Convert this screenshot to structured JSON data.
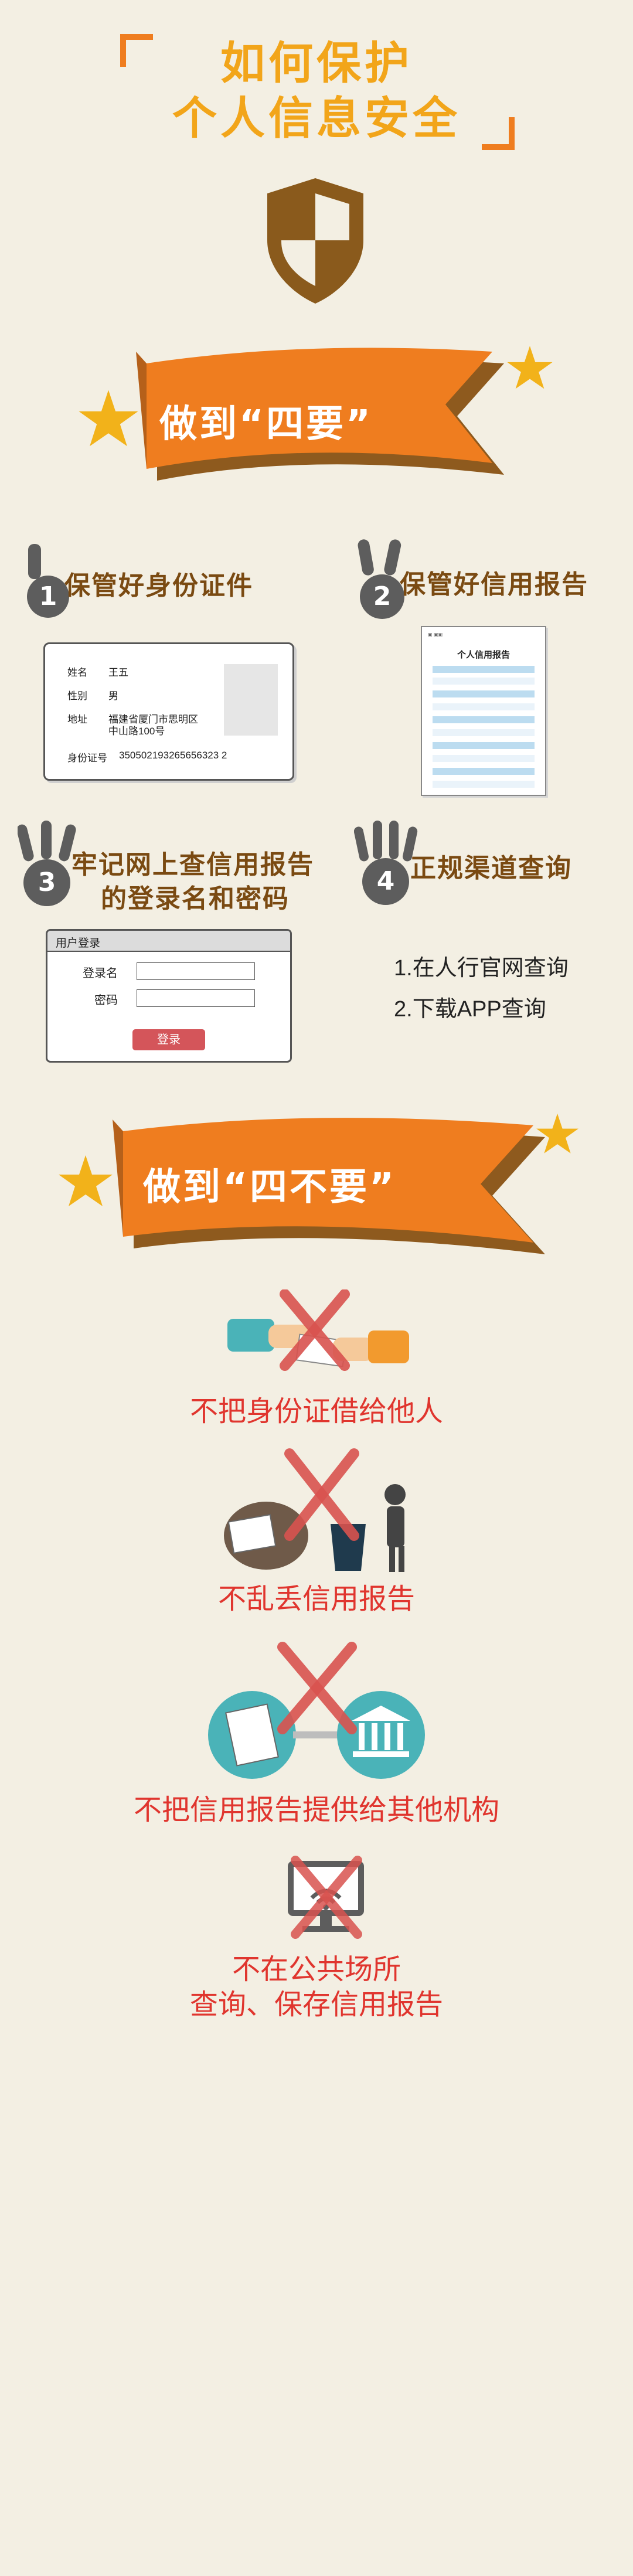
{
  "title": {
    "line1": "如何保护",
    "line2": "个人信息安全"
  },
  "banner1": {
    "text": "做到“四要”"
  },
  "banner2": {
    "text": "做到“四不要”"
  },
  "musts": [
    {
      "num": "1",
      "title": "保管好身份证件"
    },
    {
      "num": "2",
      "title": "保管好信用报告"
    },
    {
      "num": "3",
      "title_line1": "牢记网上查信用报告",
      "title_line2": "的登录名和密码"
    },
    {
      "num": "4",
      "title": "正规渠道查询"
    }
  ],
  "id_card": {
    "name_label": "姓名",
    "name_value": "王五",
    "gender_label": "性别",
    "gender_value": "男",
    "address_label": "地址",
    "address_line1": "福建省厦门市思明区",
    "address_line2": "中山路100号",
    "idno_label": "身份证号",
    "idno_value": "350502193265656323 2"
  },
  "report": {
    "title": "个人信用报告"
  },
  "login": {
    "header": "用户登录",
    "username_label": "登录名",
    "password_label": "密码",
    "submit": "登录"
  },
  "query_methods": [
    "1.在人行官网查询",
    "2.下载APP查询"
  ],
  "donts": [
    {
      "caption": "不把身份证借给他人"
    },
    {
      "caption": "不乱丢信用报告"
    },
    {
      "caption": "不把信用报告提供给其他机构"
    },
    {
      "caption_line1": "不在公共场所",
      "caption_line2": "查询、保存信用报告"
    }
  ],
  "colors": {
    "orange": "#ef7d1f",
    "gold": "#f2a51a",
    "brown": "#7a4a12",
    "red": "#e0352e",
    "teal": "#4ab3b8"
  }
}
